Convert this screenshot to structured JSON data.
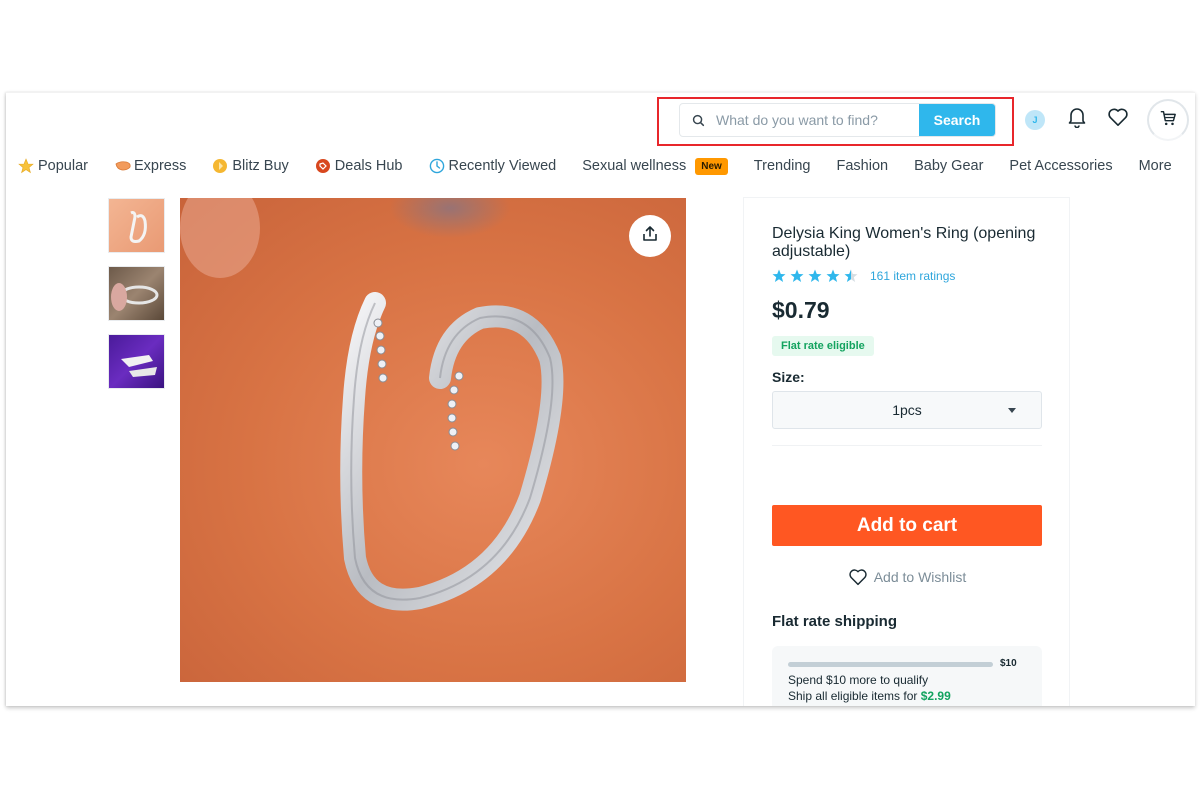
{
  "header": {
    "search": {
      "placeholder": "What do you want to find?",
      "value": "",
      "button_label": "Search"
    },
    "avatar_initial": "J",
    "icons": [
      "bell-icon",
      "heart-icon",
      "cart-icon"
    ]
  },
  "nav": {
    "items": [
      {
        "label": "Popular",
        "icon": "star-icon"
      },
      {
        "label": "Express",
        "icon": "express-icon"
      },
      {
        "label": "Blitz Buy",
        "icon": "blitz-icon"
      },
      {
        "label": "Deals Hub",
        "icon": "tag-icon"
      },
      {
        "label": "Recently Viewed",
        "icon": "clock-icon"
      },
      {
        "label": "Sexual wellness",
        "badge": "New"
      },
      {
        "label": "Trending"
      },
      {
        "label": "Fashion"
      },
      {
        "label": "Baby Gear"
      },
      {
        "label": "Pet Accessories"
      },
      {
        "label": "More"
      }
    ]
  },
  "gallery": {
    "thumbnails": [
      "ring-thumbnail-1",
      "ring-thumbnail-2",
      "ring-thumbnail-3"
    ],
    "selected_index": 0,
    "share_icon": "share-icon"
  },
  "product": {
    "title": "Delysia King Women's Ring (opening adjustable)",
    "rating": 4.5,
    "rating_max": 5,
    "ratings_label": "161 item ratings",
    "price": "$0.79",
    "flat_badge": "Flat rate eligible",
    "size_label": "Size:",
    "size_selected": "1pcs",
    "add_to_cart": "Add to cart",
    "add_to_wishlist": "Add to Wishlist"
  },
  "shipping": {
    "title": "Flat rate shipping",
    "progress_fraction": 0,
    "progress_max_label": "$10",
    "line1": "Spend $10 more to qualify",
    "line2_prefix": "Ship all eligible items for ",
    "line2_price": "$2.99"
  },
  "colors": {
    "accent_blue": "#2fb7ec",
    "cart_orange": "#ff5722",
    "badge_orange": "#ff9800",
    "success_green": "#13a35f",
    "highlight_red": "#e8262b"
  }
}
